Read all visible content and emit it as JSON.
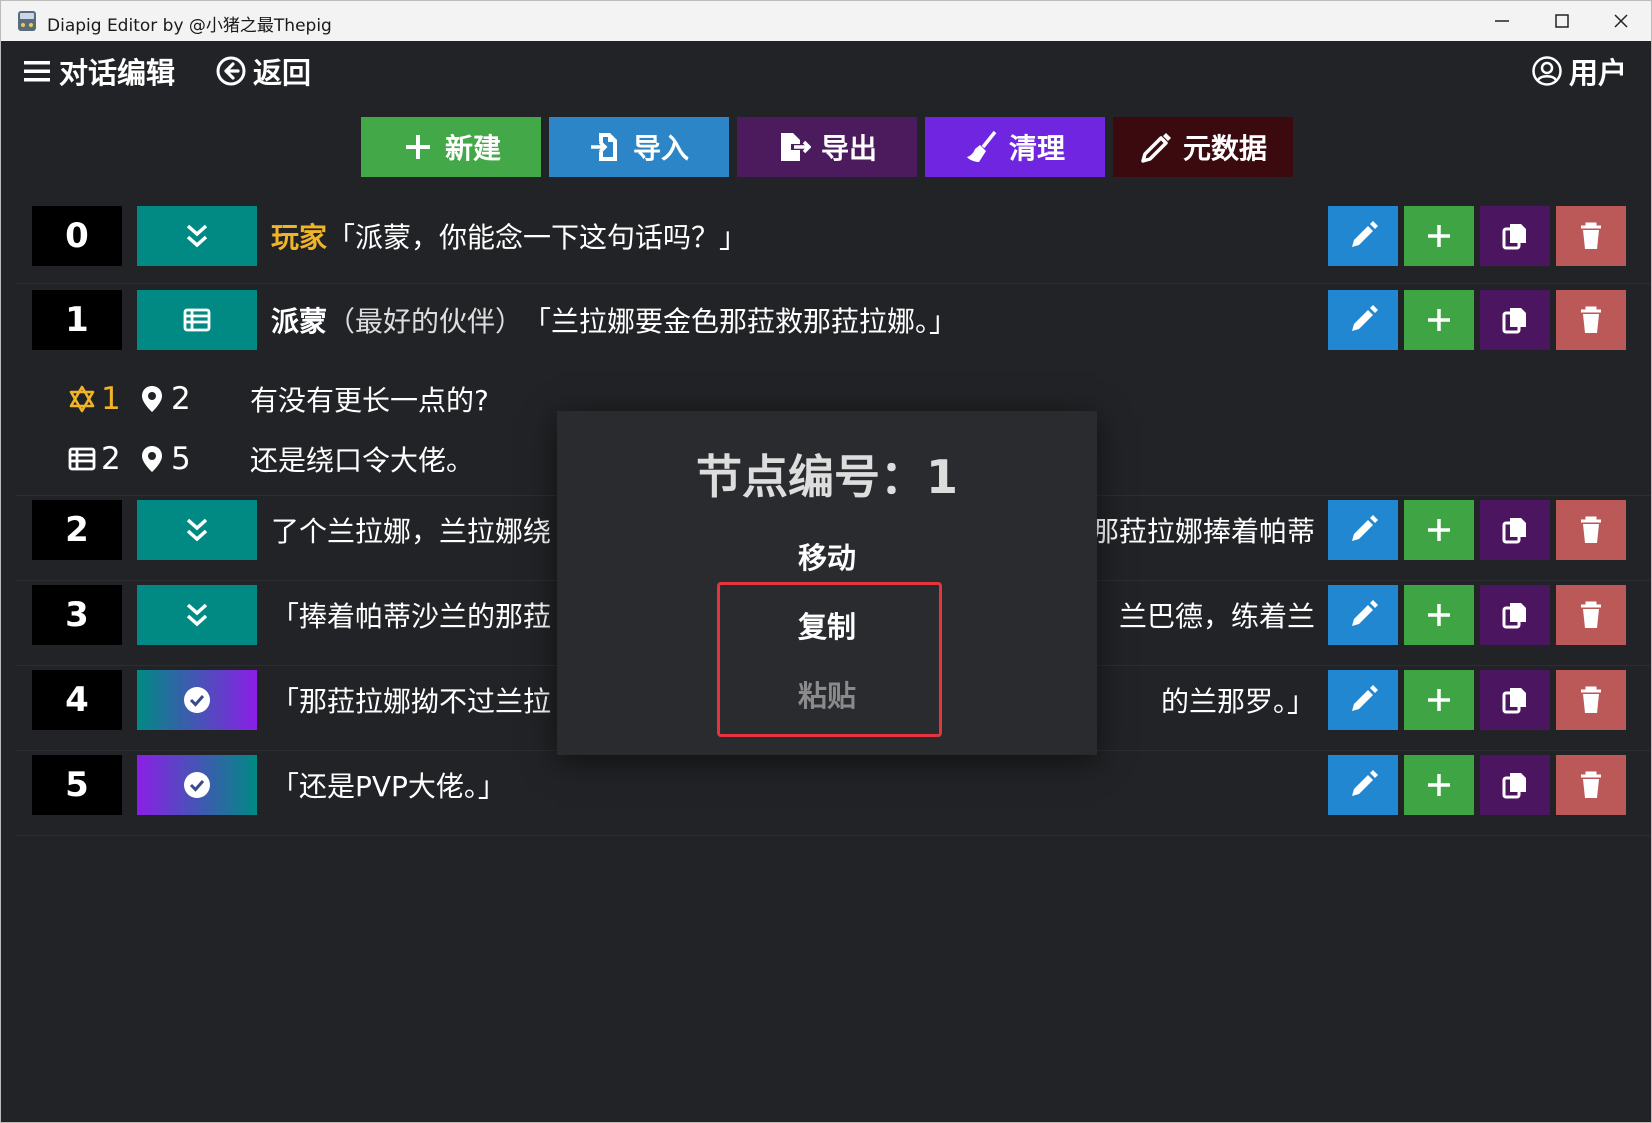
{
  "window": {
    "title": "Diapig Editor by @小猪之最Thepig"
  },
  "topbar": {
    "menu_label": "对话编辑",
    "back_label": "返回",
    "user_label": "用户"
  },
  "toolbar": {
    "new_label": "新建",
    "import_label": "导入",
    "export_label": "导出",
    "clean_label": "清理",
    "metadata_label": "元数据"
  },
  "colors": {
    "background": "#222326",
    "new": "#43a848",
    "import": "#2b85c6",
    "export": "#4b1b5e",
    "clean": "#7026e0",
    "metadata": "#3a0a0e",
    "teal": "#008a83",
    "edit": "#2187d1",
    "add": "#3fa444",
    "copy": "#4c1560",
    "delete": "#bb5959",
    "player_name": "#f0b429",
    "highlight": "#e5343b"
  },
  "rows": [
    {
      "index": "0",
      "type_icon": "double-chevron-down-icon",
      "speaker": "玩家",
      "text": "「派蒙，你能念一下这句话吗？」"
    },
    {
      "index": "1",
      "type_icon": "list-icon",
      "speaker": "派蒙",
      "note": "（最好的伙伴）",
      "text": "「兰拉娜要金色那菈救那菈拉娜。」"
    },
    {
      "index": "2",
      "type_icon": "double-chevron-down-icon",
      "text_left": "了个兰拉娜，兰拉娜绕",
      "text_right": "那菈拉娜捧着帕蒂"
    },
    {
      "index": "3",
      "type_icon": "double-chevron-down-icon",
      "text_left": "「捧着帕蒂沙兰的那菈",
      "text_right": "兰巴德，练着兰"
    },
    {
      "index": "4",
      "type_icon": "check-circle-icon",
      "text_left": "「那菈拉娜拗不过兰拉",
      "text_right": "的兰那罗。」"
    },
    {
      "index": "5",
      "type_icon": "check-circle-icon",
      "text": "「还是PVP大佬。」"
    }
  ],
  "options": [
    {
      "n1": "1",
      "n2": "2",
      "icon1": "star-of-david-icon",
      "icon2": "map-pin-icon",
      "text": "有没有更长一点的?"
    },
    {
      "n1": "2",
      "n2": "5",
      "icon1": "list-icon",
      "icon2": "map-pin-icon",
      "text": "还是绕口令大佬。"
    }
  ],
  "modal": {
    "title": "节点编号：1",
    "move": "移动",
    "copy": "复制",
    "paste": "粘贴"
  }
}
